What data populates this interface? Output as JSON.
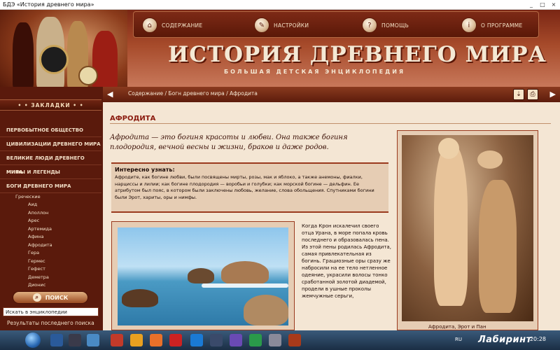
{
  "window": {
    "title": "БДЭ «История древнего мира»"
  },
  "nav": {
    "items": [
      {
        "label": "СОДЕРЖАНИЕ",
        "icon": "house-icon"
      },
      {
        "label": "НАСТРОЙКИ",
        "icon": "wrench-icon"
      },
      {
        "label": "ПОМОЩЬ",
        "icon": "help-icon"
      },
      {
        "label": "О ПРОГРАММЕ",
        "icon": "info-icon"
      }
    ]
  },
  "header": {
    "logo": "ИСТОРИЯ ДРЕВНЕГО МИРА",
    "tagline": "БОЛЬШАЯ ДЕТСКАЯ ЭНЦИКЛОПЕДИЯ"
  },
  "sidebar": {
    "bookmarks": "• • ЗАКЛАДКИ • •",
    "categories": [
      "ПЕРВОБЫТНОЕ ОБЩЕСТВО",
      "ЦИВИЛИЗАЦИИ ДРЕВНЕГО МИРА",
      "ВЕЛИКИЕ ЛЮДИ ДРЕВНЕГО МИРА",
      "МИФЫ И ЛЕГЕНДЫ",
      "БОГИ ДРЕВНЕГО МИРА"
    ],
    "subheading": "Греческие",
    "subitems": [
      "Аид",
      "Аполлон",
      "Арес",
      "Артемида",
      "Афина",
      "Афродита",
      "Гера",
      "Гермес",
      "Гефест",
      "Деметра",
      "Дионис"
    ],
    "search_label": "ПОИСК",
    "search_placeholder": "Искать в энциклопедии",
    "last_results": "Результаты последнего поиска"
  },
  "content": {
    "breadcrumb": "Содержание / Богн древнего мира / Афродита",
    "title": "АФРОДИТА",
    "intro": "Афродита — это богиня красоты и любви. Она также богиня плодородия, вечной весны и жизни, браков и даже родов.",
    "interesting_heading": "Интересно узнать:",
    "interesting_text": "Афродите, как богине любви, были посвящены мирты, розы, мак и яблоко, а также анемоны, фиалки, нарциссы и лилии; как богине плодородия — воробьи и голубки; как морской богине — дельфин. Ее атрибутом был пояс, в котором были заключены любовь, желание, слова обольщения. Спутниками богини были Эрот, хариты, оры и нимфы.",
    "body": "Когда Крон искалечил своего отца Урана, в море попала кровь последнего и образовалась пена. Из этой пены родилась Афродита, самая привлекательная из богинь. Грациозные оры сразу же набросили на ее тело нетленное одеяние, украсили волосы тонко сработанной золотой диадемой, продели в ушные проколы жемчужные серьги,",
    "caption": "Афродита, Эрот и Пан"
  },
  "taskbar": {
    "lang": "RU",
    "clock": "20:28",
    "brand": "Лабиринт"
  },
  "colors": {
    "accent": "#8a1a0e",
    "sidebar_bg": "#5a1a0c",
    "content_bg": "#f4e6d4"
  }
}
